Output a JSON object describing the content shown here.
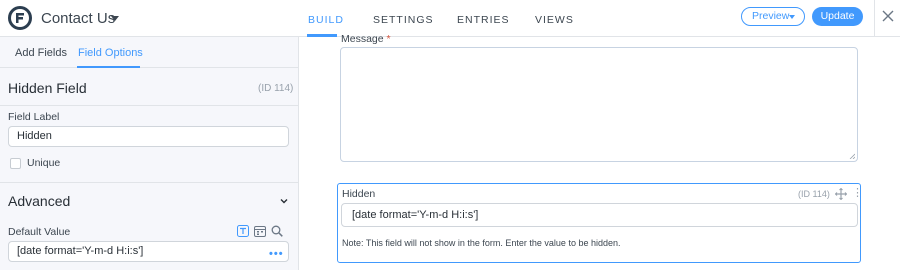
{
  "header": {
    "form_title": "Contact Us",
    "tabs": [
      {
        "label": "BUILD",
        "active": true
      },
      {
        "label": "SETTINGS",
        "active": false
      },
      {
        "label": "ENTRIES",
        "active": false
      },
      {
        "label": "VIEWS",
        "active": false
      }
    ],
    "preview_label": "Preview",
    "update_label": "Update"
  },
  "sidebar": {
    "tabs": [
      {
        "label": "Add Fields",
        "active": false
      },
      {
        "label": "Field Options",
        "active": true
      }
    ],
    "field_heading": "Hidden Field",
    "field_id": "(ID 114)",
    "field_label_caption": "Field Label",
    "field_label_value": "Hidden",
    "unique_label": "Unique",
    "unique_checked": false,
    "advanced_heading": "Advanced",
    "default_value_caption": "Default Value",
    "default_value": "[date format='Y-m-d H:i:s']"
  },
  "canvas": {
    "message_label": "Message",
    "message_required_mark": "*",
    "hidden_field": {
      "label": "Hidden",
      "id": "(ID 114)",
      "value": "[date format='Y-m-d H:i:s']",
      "note": "Note: This field will not show in the form. Enter the value to be hidden."
    }
  },
  "colors": {
    "accent": "#4199fd",
    "sidebar_bg": "#f6f7fb",
    "required": "#d4543e"
  },
  "icons": {
    "logo": "formidable-logo-icon",
    "close": "close-icon",
    "collapse": "chevron-down-icon",
    "shortcode": "shortcode-icon",
    "calendar": "calendar-icon",
    "search": "search-icon",
    "more": "more-dots-icon",
    "move": "move-icon",
    "menu": "vertical-dots-icon"
  }
}
